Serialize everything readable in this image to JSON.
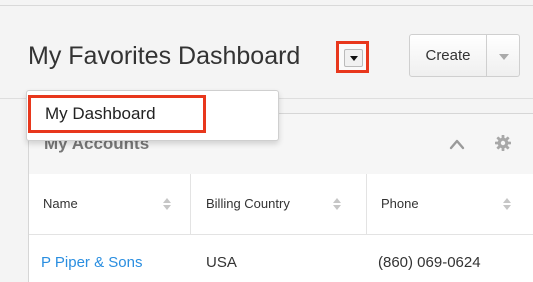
{
  "header": {
    "title": "My Favorites Dashboard",
    "create_label": "Create"
  },
  "dropdown_menu": {
    "items": [
      {
        "label": "My Dashboard"
      }
    ]
  },
  "dashlet": {
    "title": "My Accounts",
    "columns": [
      "Name",
      "Billing Country",
      "Phone"
    ],
    "rows": [
      {
        "name": "P Piper & Sons",
        "billing_country": "USA",
        "phone": "(860) 069-0624"
      }
    ]
  },
  "colors": {
    "highlight": "#e8371c",
    "link": "#2a8ee0"
  },
  "icons": [
    "caret-down-icon",
    "chevron-up-icon",
    "gear-icon",
    "sort-icon"
  ]
}
